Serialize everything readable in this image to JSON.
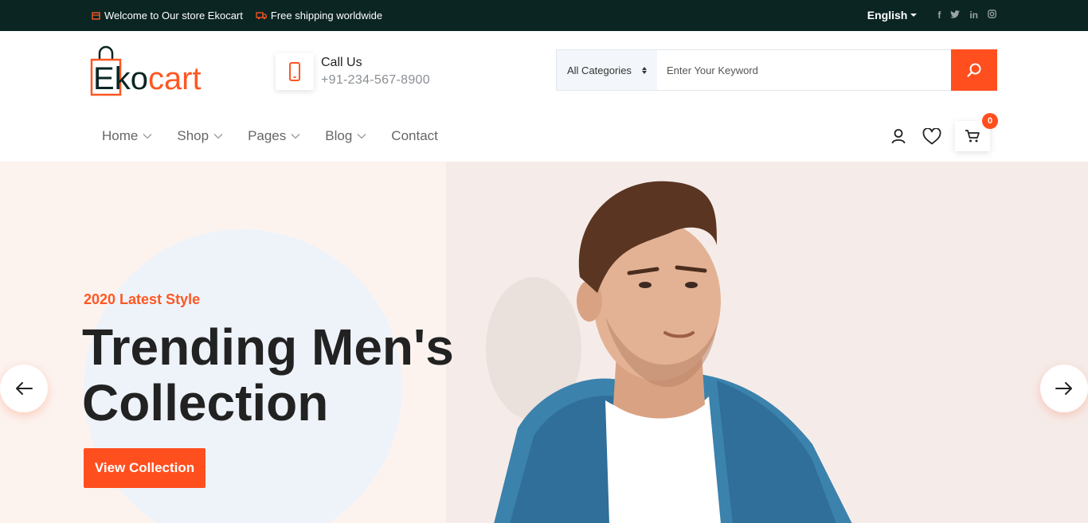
{
  "topbar": {
    "welcome": "Welcome to Our store Ekocart",
    "shipping": "Free shipping worldwide",
    "language": "English",
    "social": [
      "f",
      "t",
      "in",
      "ig"
    ]
  },
  "header": {
    "logo": {
      "first": "E",
      "rest_dark": "ko",
      "rest_orange": "cart"
    },
    "call": {
      "title": "Call Us",
      "number": "+91-234-567-8900"
    },
    "search": {
      "category": "All Categories",
      "placeholder": "Enter Your Keyword"
    },
    "cart_count": "0",
    "colors": {
      "accent": "#ff4f1f",
      "dark": "#0b2523"
    }
  },
  "nav": {
    "items": [
      {
        "label": "Home"
      },
      {
        "label": "Shop"
      },
      {
        "label": "Pages"
      },
      {
        "label": "Blog"
      },
      {
        "label": "Contact"
      }
    ]
  },
  "hero": {
    "tag": "2020 Latest Style",
    "title_line1": "Trending Men's",
    "title_line2": "Collection",
    "cta": "View Collection"
  }
}
